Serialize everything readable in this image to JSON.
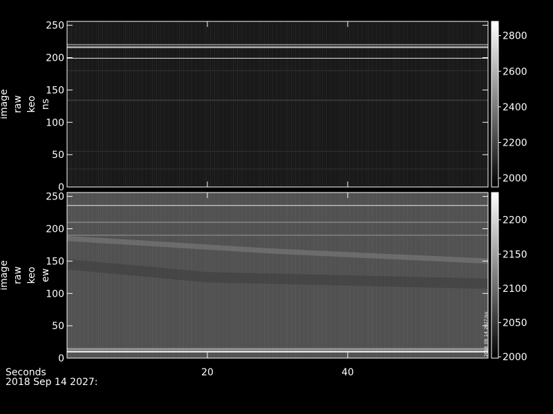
{
  "footer": {
    "x_label": "Seconds",
    "date_label": "2018 Sep 14 2027:"
  },
  "chart_data": [
    {
      "type": "heatmap",
      "ylabel_lines": [
        "image",
        "raw",
        "keo",
        "ns"
      ],
      "ylim": [
        0,
        256
      ],
      "yticks": [
        0,
        50,
        100,
        150,
        200,
        250
      ],
      "xlim": [
        0,
        60
      ],
      "xticks": [
        20,
        40
      ],
      "xtick_labels": [],
      "colorbar": {
        "min": 1950,
        "max": 2880,
        "ticks": [
          2000,
          2200,
          2400,
          2600,
          2800
        ]
      },
      "base_value": 2040,
      "bands": [
        {
          "y": 216,
          "value": 2720,
          "width": 2.5
        },
        {
          "y": 220,
          "value": 2480,
          "width": 2
        },
        {
          "y": 199,
          "value": 2880,
          "width": 0.6
        },
        {
          "y": 180,
          "value": 2150,
          "width": 1
        },
        {
          "y": 134,
          "value": 2170,
          "width": 2
        },
        {
          "y": 55,
          "value": 2140,
          "width": 0.8
        },
        {
          "y": 28,
          "value": 2110,
          "width": 1.5
        }
      ]
    },
    {
      "type": "heatmap",
      "ylabel_lines": [
        "image",
        "raw",
        "keo",
        "ew"
      ],
      "ylim": [
        0,
        256
      ],
      "yticks": [
        0,
        50,
        100,
        150,
        200,
        250
      ],
      "xlim": [
        0,
        60
      ],
      "xticks": [
        20,
        40
      ],
      "xtick_labels": [
        "20",
        "40"
      ],
      "colorbar": {
        "min": 1998,
        "max": 2240,
        "ticks": [
          2000,
          2050,
          2100,
          2150,
          2200
        ]
      },
      "base_value": 2075,
      "bands": [
        {
          "y": 236,
          "value": 2240,
          "width": 0.8
        },
        {
          "y": 210,
          "value": 2120,
          "width": 2
        },
        {
          "y": 190,
          "value": 2115,
          "width": 2
        },
        {
          "y": 10,
          "value": 2240,
          "width": 2.5
        },
        {
          "y": 14,
          "value": 2150,
          "width": 3
        }
      ],
      "sloped_bands": [
        {
          "x": [
            0,
            30,
            60
          ],
          "y": [
            185,
            165,
            150
          ],
          "value": 2120,
          "width": 4
        },
        {
          "x": [
            0,
            20,
            60
          ],
          "y": [
            145,
            125,
            115
          ],
          "value": 2055,
          "width": 8
        }
      ],
      "side_note": "2018_09_14_2027.iso"
    }
  ]
}
